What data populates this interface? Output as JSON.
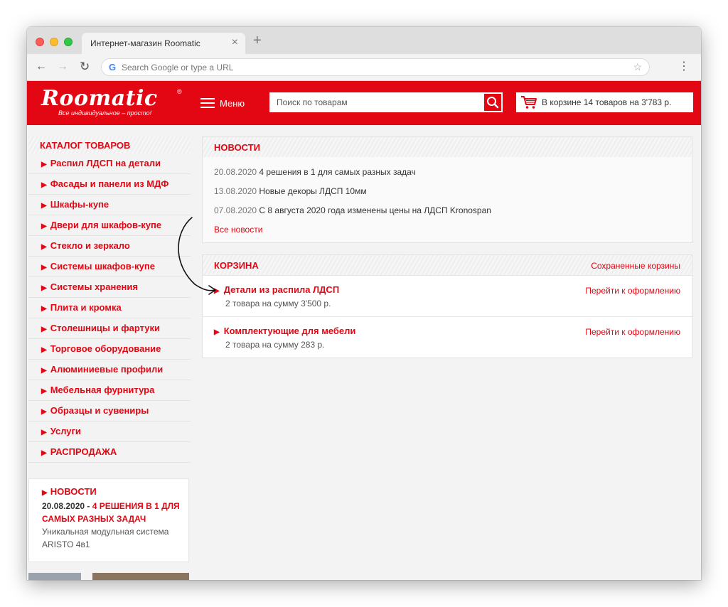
{
  "browser": {
    "tab_title": "Интернет-магазин Roomatic",
    "tab_close": "×",
    "new_tab": "+",
    "omnibox_placeholder": "Search Google or type a URL",
    "g_letter": "G"
  },
  "header": {
    "logo_text": "Roomatic",
    "logo_reg": "®",
    "logo_tagline": "Все индивидуальное – просто!",
    "menu_label": "Меню",
    "search_placeholder": "Поиск по товарам",
    "cart_summary": "В корзине 14 товаров на 3'783 р.",
    "brand_color": "#e30613"
  },
  "sidebar": {
    "catalog_title": "КАТАЛОГ ТОВАРОВ",
    "items": [
      "Распил ЛДСП на детали",
      "Фасады и панели из МДФ",
      "Шкафы-купе",
      "Двери для шкафов-купе",
      "Стекло и зеркало",
      "Системы шкафов-купе",
      "Системы хранения",
      "Плита и кромка",
      "Столешницы и фартуки",
      "Торговое оборудование",
      "Алюминиевые профили",
      "Мебельная фурнитура",
      "Образцы и сувениры",
      "Услуги",
      "РАСПРОДАЖА"
    ],
    "news": {
      "title": "НОВОСТИ",
      "date": "20.08.2020",
      "separator": " - ",
      "headline": "4 РЕШЕНИЯ В 1 ДЛЯ САМЫХ РАЗНЫХ ЗАДАЧ",
      "body": "Уникальная модульная система ARISTO 4в1"
    }
  },
  "news_panel": {
    "title": "НОВОСТИ",
    "items": [
      {
        "date": "20.08.2020",
        "text": "4 решения в 1 для самых разных задач"
      },
      {
        "date": "13.08.2020",
        "text": "Новые декоры ЛДСП 10мм"
      },
      {
        "date": "07.08.2020",
        "text": "С 8 августа 2020 года изменены цены на ЛДСП Kronospan"
      }
    ],
    "all_news": "Все новости"
  },
  "cart_panel": {
    "title": "КОРЗИНА",
    "saved_carts": "Сохраненные корзины",
    "rows": [
      {
        "title": "Детали из распила ЛДСП",
        "subtitle": "2 товара на сумму 3'500 р.",
        "action": "Перейти к оформлению"
      },
      {
        "title": "Комплектующие для мебели",
        "subtitle": "2 товара на сумму 283 р.",
        "action": "Перейти к оформлению"
      }
    ]
  }
}
